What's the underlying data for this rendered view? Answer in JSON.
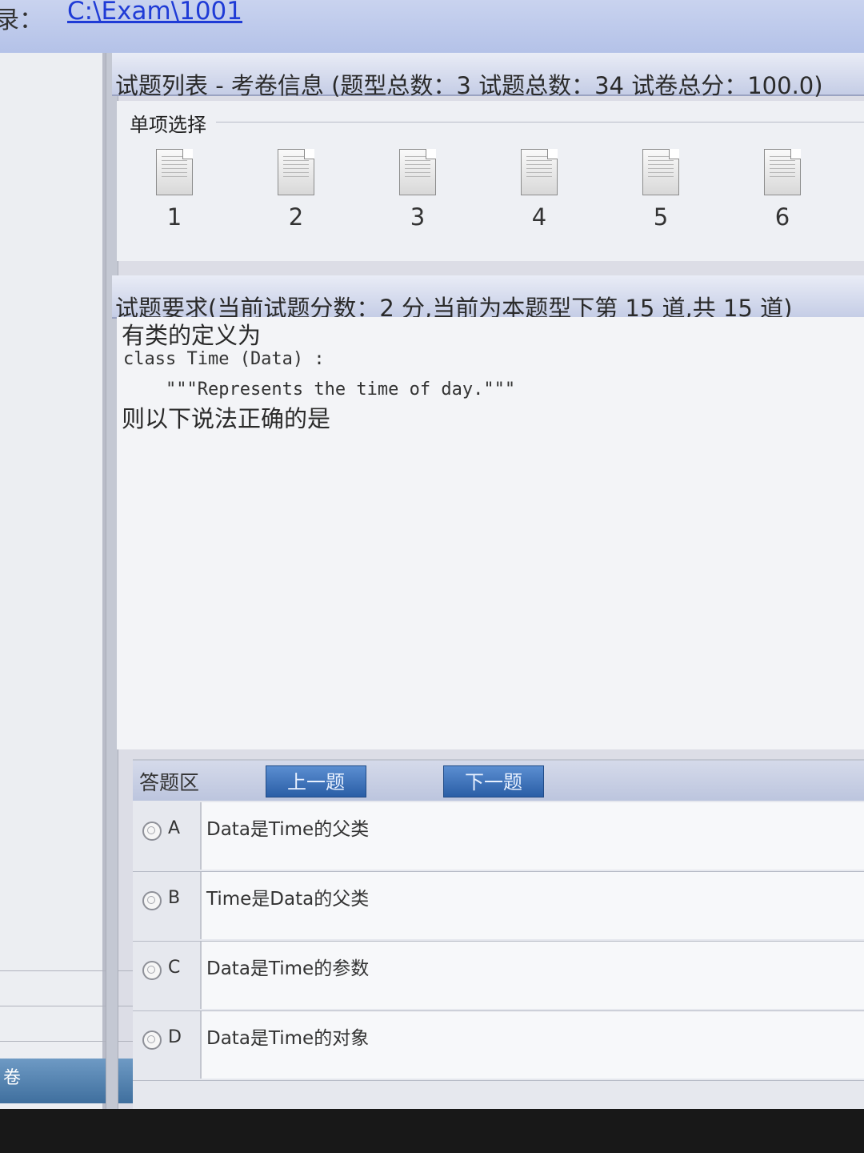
{
  "topbar": {
    "dir_label": "录：",
    "dir_path": "C:\\Exam\\1001"
  },
  "list_panel": {
    "title": "试题列表 - 考卷信息 (题型总数：3  试题总数：34  试卷总分：100.0)",
    "section": "单项选择",
    "questions": [
      "1",
      "2",
      "3",
      "4",
      "5",
      "6"
    ]
  },
  "requirement_panel": {
    "title": "试题要求(当前试题分数：2 分,当前为本题型下第 15 道,共 15 道)",
    "line1": "有类的定义为",
    "code1": "class Time (Data) :",
    "code2": "    \"\"\"Represents the time of day.\"\"\"",
    "line4": "则以下说法正确的是"
  },
  "answer_panel": {
    "label": "答题区",
    "prev_label": "上一题",
    "next_label": "下一题",
    "options": [
      {
        "letter": "A",
        "text": "Data是Time的父类"
      },
      {
        "letter": "B",
        "text": "Time是Data的父类"
      },
      {
        "letter": "C",
        "text": "Data是Time的参数"
      },
      {
        "letter": "D",
        "text": "Data是Time的对象"
      }
    ]
  },
  "left_panel": {
    "bottom_text": "卷"
  }
}
